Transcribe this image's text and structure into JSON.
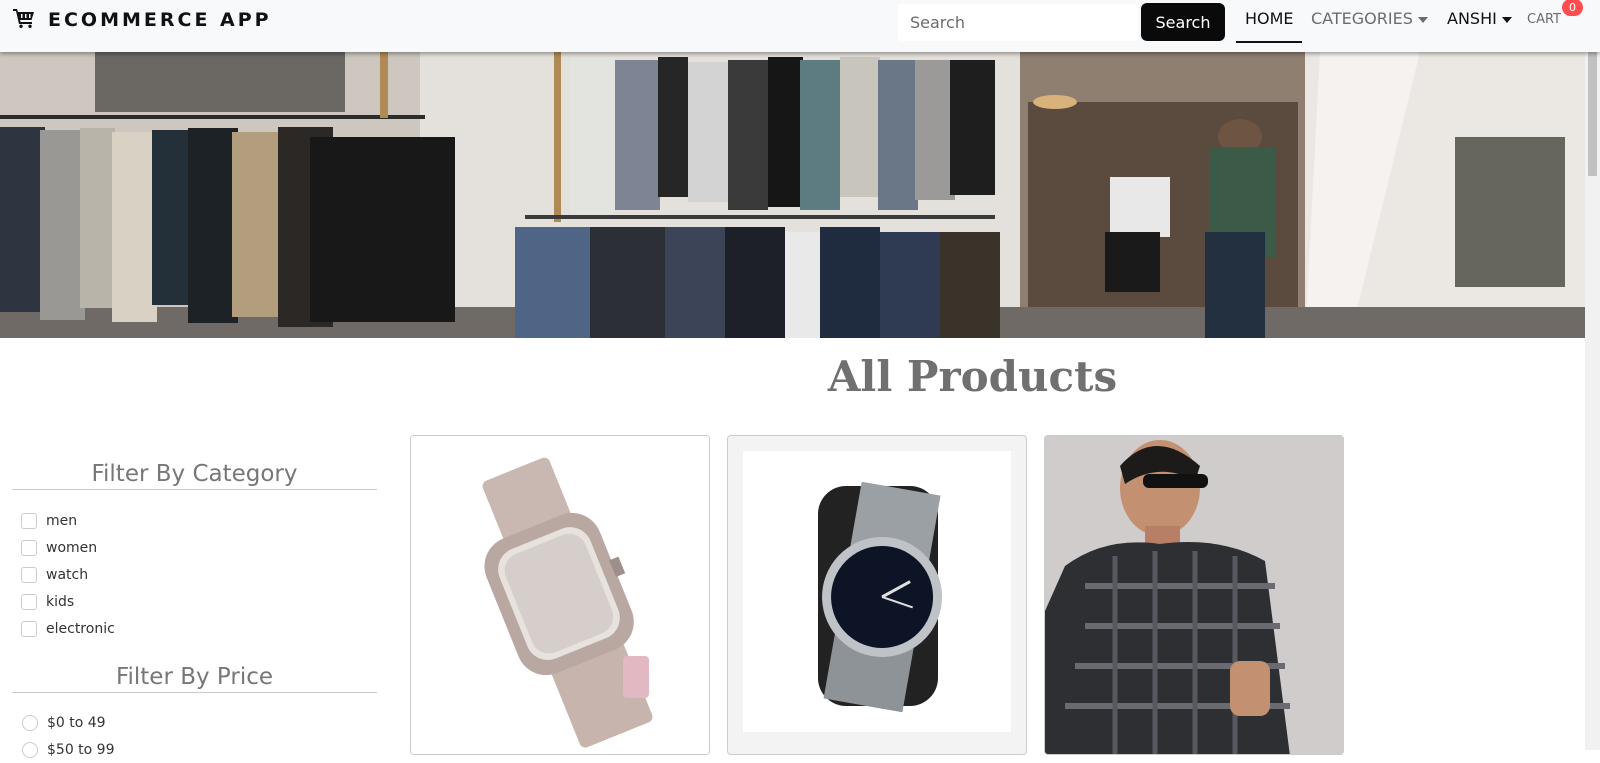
{
  "navbar": {
    "brand": "ECOMMERCE APP",
    "search_placeholder": "Search",
    "search_button": "Search",
    "links": {
      "home": "HOME",
      "categories": "CATEGORIES",
      "user": "ANSHI",
      "cart": "CART"
    },
    "cart_count": "0"
  },
  "main": {
    "title": "All Products"
  },
  "filters": {
    "category_heading": "Filter By Category",
    "categories": [
      "men",
      "women",
      "watch",
      "kids",
      "electronic"
    ],
    "price_heading": "Filter By Price",
    "prices": [
      "$0 to 49",
      "$50 to 99"
    ]
  },
  "products": [
    {
      "image": "diamond-studded-watch"
    },
    {
      "image": "black-dial-steel-watch"
    },
    {
      "image": "checked-shirt-man"
    }
  ],
  "icons": {
    "brand": "shopping-cart-icon",
    "dropdown": "caret-down-icon"
  },
  "colors": {
    "navbar_bg": "#f8f9fa",
    "search_button_bg": "#0a0a0a",
    "cart_badge": "#ff4d4f",
    "title_text": "#707070"
  }
}
